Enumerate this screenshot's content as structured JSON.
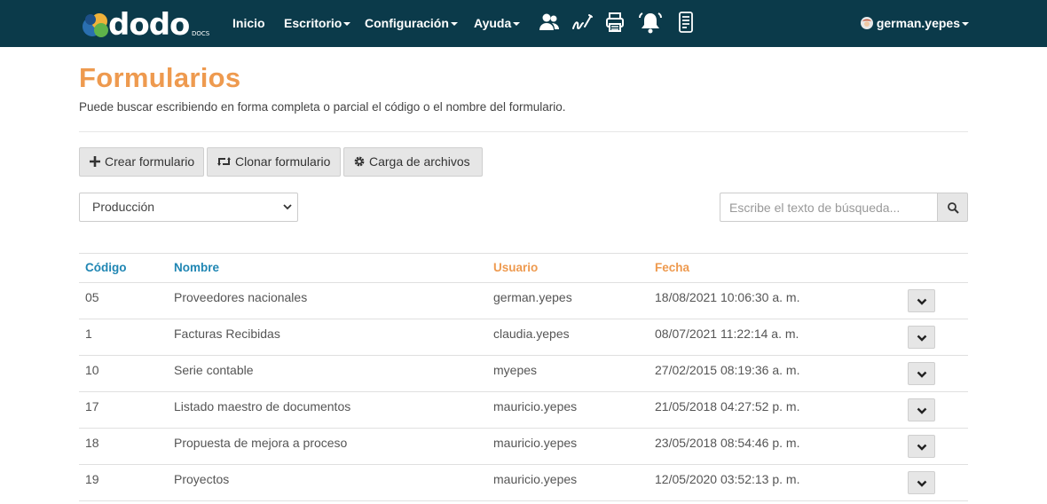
{
  "navbar": {
    "logo_text": "dodo",
    "logo_sub": "DOCS",
    "menu": [
      {
        "label": "Inicio",
        "dropdown": false
      },
      {
        "label": "Escritorio",
        "dropdown": true
      },
      {
        "label": "Configuración",
        "dropdown": true
      },
      {
        "label": "Ayuda",
        "dropdown": true
      }
    ],
    "icons": [
      "users-icon",
      "signature-icon",
      "printer-icon",
      "bell-icon",
      "document-list-icon"
    ],
    "user": "german.yepes"
  },
  "header": {
    "title": "Formularios",
    "subtitle": "Puede buscar escribiendo en forma completa o parcial el código o el nombre del formulario."
  },
  "toolbar": {
    "create_label": "Crear formulario",
    "clone_label": "Clonar formulario",
    "upload_label": "Carga de archivos"
  },
  "filter": {
    "environment_selected": "Producción",
    "search_placeholder": "Escribe el texto de búsqueda..."
  },
  "table": {
    "columns": [
      "Código",
      "Nombre",
      "Usuario",
      "Fecha"
    ],
    "rows": [
      {
        "code": "05",
        "name": "Proveedores nacionales",
        "user": "german.yepes",
        "date": "18/08/2021 10:06:30 a. m."
      },
      {
        "code": "1",
        "name": "Facturas Recibidas",
        "user": "claudia.yepes",
        "date": "08/07/2021 11:22:14 a. m."
      },
      {
        "code": "10",
        "name": "Serie contable",
        "user": "myepes",
        "date": "27/02/2015 08:19:36 a. m."
      },
      {
        "code": "17",
        "name": "Listado maestro de documentos",
        "user": "mauricio.yepes",
        "date": "21/05/2018 04:27:52 p. m."
      },
      {
        "code": "18",
        "name": "Propuesta de mejora a proceso",
        "user": "mauricio.yepes",
        "date": "23/05/2018 08:54:46 p. m."
      },
      {
        "code": "19",
        "name": "Proyectos",
        "user": "mauricio.yepes",
        "date": "12/05/2020 03:52:13 p. m."
      }
    ]
  },
  "colors": {
    "navbar_bg": "#0b3a4a",
    "title_orange": "#ee9a4f",
    "header_blue": "#1f86b3"
  }
}
